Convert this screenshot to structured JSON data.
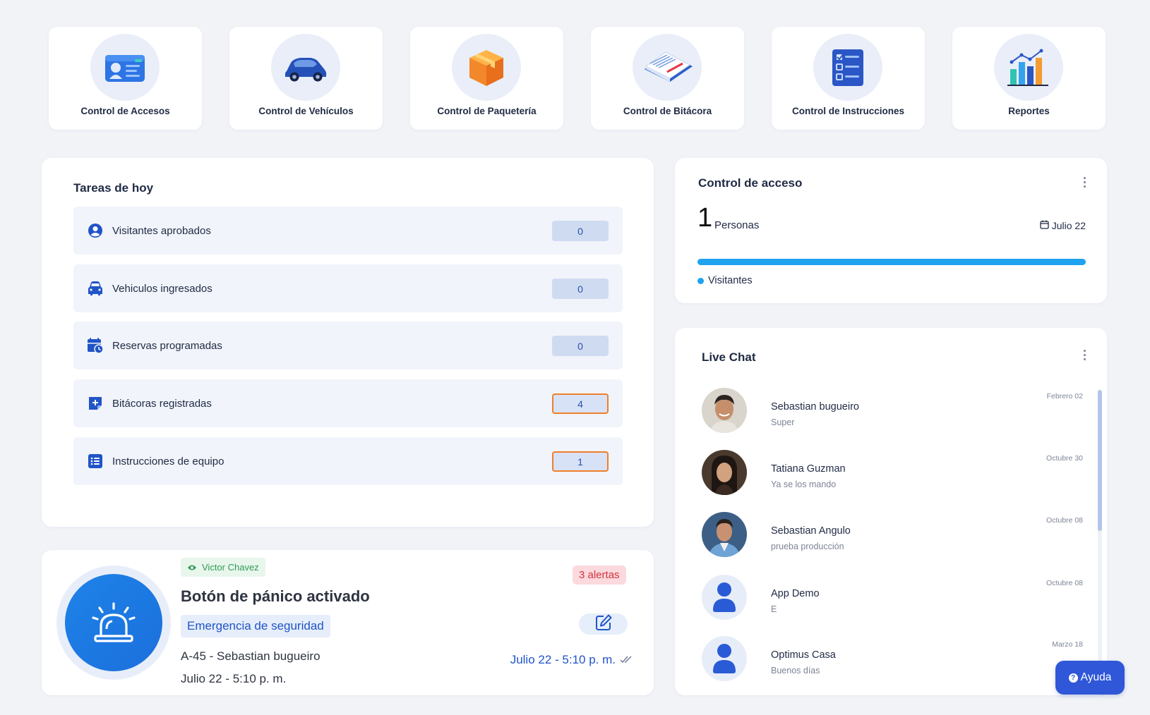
{
  "shortcuts": [
    {
      "label": "Control de Accesos",
      "icon": "id-card-icon"
    },
    {
      "label": "Control de Vehículos",
      "icon": "car-icon"
    },
    {
      "label": "Control de Paquetería",
      "icon": "package-icon"
    },
    {
      "label": "Control de Bitácora",
      "icon": "logbook-icon"
    },
    {
      "label": "Control de Instrucciones",
      "icon": "checklist-icon"
    },
    {
      "label": "Reportes",
      "icon": "bar-chart-icon"
    }
  ],
  "tasks": {
    "title": "Tareas de hoy",
    "items": [
      {
        "label": "Visitantes aprobados",
        "count": "0",
        "icon": "user-circle-icon"
      },
      {
        "label": "Vehiculos ingresados",
        "count": "0",
        "icon": "car-front-icon"
      },
      {
        "label": "Reservas programadas",
        "count": "0",
        "icon": "calendar-clock-icon"
      },
      {
        "label": "Bitácoras registradas",
        "count": "4",
        "icon": "add-note-icon"
      },
      {
        "label": "Instrucciones de equipo",
        "count": "1",
        "icon": "list-icon"
      }
    ]
  },
  "panic": {
    "viewer": "Victor Chavez",
    "title": "Botón de pánico activado",
    "type": "Emergencia de seguridad",
    "unit_person": "A-45 - Sebastian bugueiro",
    "datetime": "Julio 22 - 5:10 p. m.",
    "alerts": "3 alertas",
    "timestamp": "Julio 22 - 5:10 p. m."
  },
  "access": {
    "title": "Control de acceso",
    "count": "1",
    "unit": "Personas",
    "date": "Julio 22",
    "legend": "Visitantes",
    "visitors_fraction": 1.0,
    "accent": "#1fa2ef"
  },
  "chat": {
    "title": "Live Chat",
    "items": [
      {
        "name": "Sebastian bugueiro",
        "message": "Super",
        "date": "Febrero 02"
      },
      {
        "name": "Tatiana Guzman",
        "message": "Ya se los mando",
        "date": "Octubre 30"
      },
      {
        "name": "Sebastian Angulo",
        "message": "prueba producción",
        "date": "Octubre 08"
      },
      {
        "name": "App Demo",
        "message": "E",
        "date": "Octubre 08"
      },
      {
        "name": "Optimus Casa",
        "message": "Buenos días",
        "date": "Marzo 18"
      }
    ]
  },
  "help": {
    "label": "Ayuda"
  }
}
